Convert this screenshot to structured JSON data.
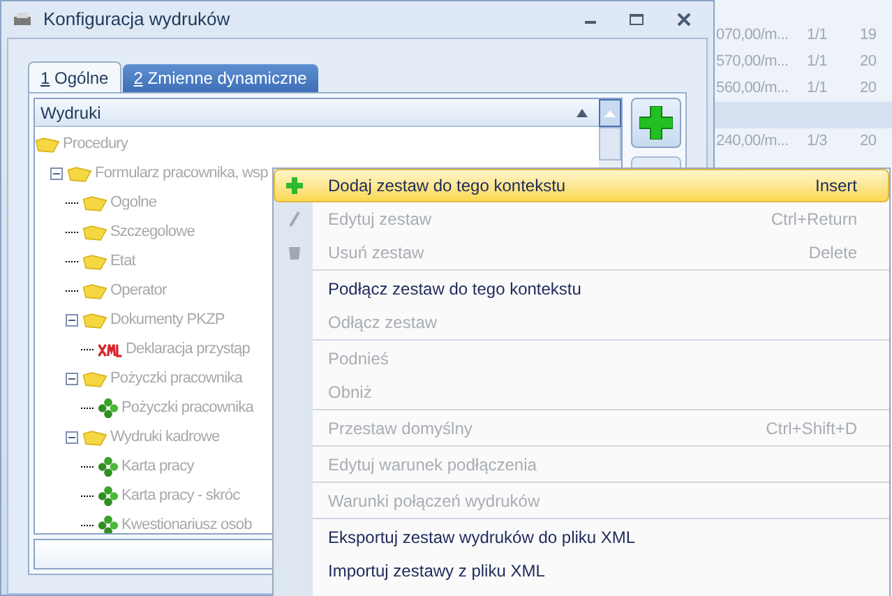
{
  "window": {
    "title": "Konfiguracja wydruków"
  },
  "background_table": {
    "rows": [
      {
        "cells": [
          "070,00/m...",
          "1/1",
          "19"
        ],
        "selected": false
      },
      {
        "cells": [
          "570,00/m...",
          "1/1",
          "20"
        ],
        "selected": false
      },
      {
        "cells": [
          "560,00/m...",
          "1/1",
          "20"
        ],
        "selected": false
      },
      {
        "cells": [],
        "selected": true
      },
      {
        "cells": [
          "240,00/m...",
          "1/3",
          "20"
        ],
        "selected": false
      }
    ]
  },
  "tabs": [
    {
      "hotkey": "1",
      "label": " Ogólne",
      "selected": true
    },
    {
      "hotkey": "2",
      "label": " Zmienne dynamiczne",
      "selected": false
    }
  ],
  "tree": {
    "header": "Wydruki",
    "items": [
      {
        "kind": "folder",
        "label": "Procedury",
        "children": [
          {
            "kind": "folder",
            "label": "Formularz pracownika, wsp",
            "expanded": true,
            "children": [
              {
                "kind": "folder",
                "label": "Ogolne"
              },
              {
                "kind": "folder",
                "label": "Szczegolowe"
              },
              {
                "kind": "folder",
                "label": "Etat"
              },
              {
                "kind": "folder",
                "label": "Operator"
              },
              {
                "kind": "folder",
                "label": "Dokumenty PKZP",
                "expanded": true,
                "children": [
                  {
                    "kind": "xml",
                    "label": "Deklaracja przystąp"
                  }
                ]
              },
              {
                "kind": "folder",
                "label": "Pożyczki pracownika",
                "expanded": true,
                "children": [
                  {
                    "kind": "set",
                    "label": "Pożyczki pracownika"
                  }
                ]
              },
              {
                "kind": "folder",
                "label": "Wydruki kadrowe",
                "expanded": true,
                "children": [
                  {
                    "kind": "set",
                    "label": "Karta pracy"
                  },
                  {
                    "kind": "set",
                    "label": "Karta pracy - skróc"
                  },
                  {
                    "kind": "set",
                    "label": "Kwestionariusz osob"
                  }
                ]
              }
            ]
          }
        ]
      }
    ]
  },
  "context_menu": {
    "groups": [
      [
        {
          "label": "Dodaj zestaw do tego kontekstu",
          "shortcut": "Insert",
          "disabled": false,
          "selected": true
        },
        {
          "label": "Edytuj zestaw",
          "shortcut": "Ctrl+Return",
          "disabled": true,
          "selected": false
        },
        {
          "label": "Usuń zestaw",
          "shortcut": "Delete",
          "disabled": true,
          "selected": false
        }
      ],
      [
        {
          "label": "Podłącz zestaw do tego kontekstu",
          "disabled": false,
          "selected": false
        },
        {
          "label": "Odłącz zestaw",
          "disabled": true,
          "selected": false
        }
      ],
      [
        {
          "label": "Podnieś",
          "disabled": true,
          "selected": false
        },
        {
          "label": "Obniż",
          "disabled": true,
          "selected": false
        }
      ],
      [
        {
          "label": "Przestaw domyślny",
          "shortcut": "Ctrl+Shift+D",
          "disabled": true,
          "selected": false
        }
      ],
      [
        {
          "label": "Edytuj warunek podłączenia",
          "disabled": true,
          "selected": false
        }
      ],
      [
        {
          "label": "Warunki połączeń wydruków",
          "disabled": true,
          "selected": false
        }
      ],
      [
        {
          "label": "Eksportuj zestaw wydruków do pliku XML",
          "disabled": false,
          "selected": false
        },
        {
          "label": "Importuj zestawy z pliku XML",
          "disabled": false,
          "selected": false
        }
      ]
    ]
  }
}
